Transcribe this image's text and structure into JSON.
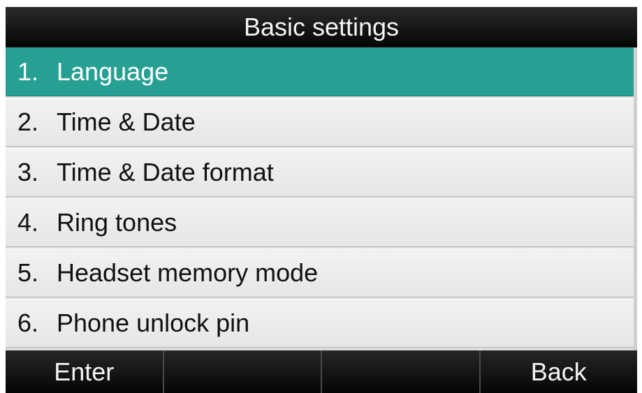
{
  "header": {
    "title": "Basic settings"
  },
  "menu": {
    "selected_index": 0,
    "items": [
      {
        "num": "1.",
        "label": "Language"
      },
      {
        "num": "2.",
        "label": "Time & Date"
      },
      {
        "num": "3.",
        "label": "Time & Date format"
      },
      {
        "num": "4.",
        "label": "Ring tones"
      },
      {
        "num": "5.",
        "label": "Headset memory mode"
      },
      {
        "num": "6.",
        "label": "Phone unlock pin"
      }
    ]
  },
  "softkeys": {
    "key1": "Enter",
    "key2": "",
    "key3": "",
    "key4": "Back"
  },
  "colors": {
    "selection": "#27a094",
    "bar_background": "#0a0a0a",
    "item_background": "#ececec"
  }
}
